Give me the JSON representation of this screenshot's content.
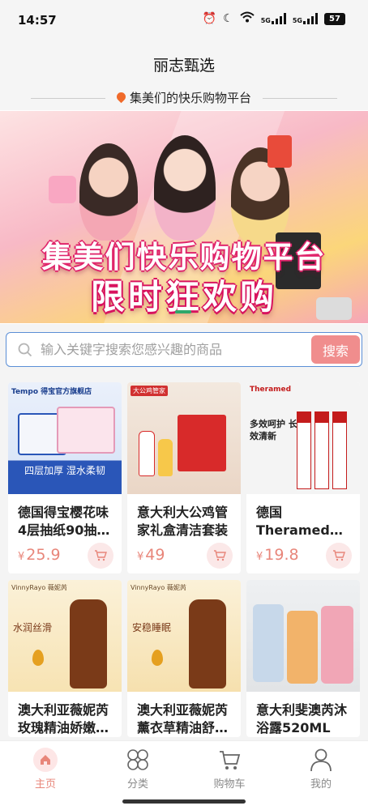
{
  "status": {
    "time": "14:57",
    "signal1": "5G",
    "signal2": "5G",
    "battery": "57"
  },
  "header": {
    "title": "丽志甄选",
    "slogan": "集美们的快乐购物平台"
  },
  "banner": {
    "line1": "集美们快乐购物平台",
    "line2": "限时狂欢购"
  },
  "search": {
    "placeholder": "输入关键字搜索您感兴趣的商品",
    "button": "搜索"
  },
  "products": [
    {
      "name": "德国得宝樱花味4层抽纸90抽…",
      "price_symbol": "¥",
      "price": "25.9",
      "img_brand": "Tempo 得宝官方旗舰店",
      "img_caption": "四层加厚 湿水柔韧"
    },
    {
      "name": "意大利大公鸡管家礼盒清洁套装",
      "price_symbol": "¥",
      "price": "49",
      "img_brand": "大公鸡管家"
    },
    {
      "name": "德国Theramed护齿达（新款…",
      "price_symbol": "¥",
      "price": "19.8",
      "img_brand": "Theramed",
      "img_caption": "多效呵护 长效清新"
    },
    {
      "name": "澳大利亚薇妮芮玫瑰精油娇嫩…",
      "img_brand": "VinnyRayo 薇妮芮",
      "img_caption": "水润丝滑"
    },
    {
      "name": "澳大利亚薇妮芮薰衣草精油舒…",
      "img_brand": "VinnyRayo 薇妮芮",
      "img_caption": "安稳睡眠"
    },
    {
      "name": "意大利斐澳芮沐浴露520ML"
    }
  ],
  "tabs": [
    {
      "label": "主页",
      "icon": "home-icon"
    },
    {
      "label": "分类",
      "icon": "category-icon"
    },
    {
      "label": "购物车",
      "icon": "cart-icon"
    },
    {
      "label": "我的",
      "icon": "user-icon"
    }
  ],
  "colors": {
    "accent": "#e8867a",
    "search_button": "#f08d8d",
    "search_border": "#5b8fd6"
  }
}
